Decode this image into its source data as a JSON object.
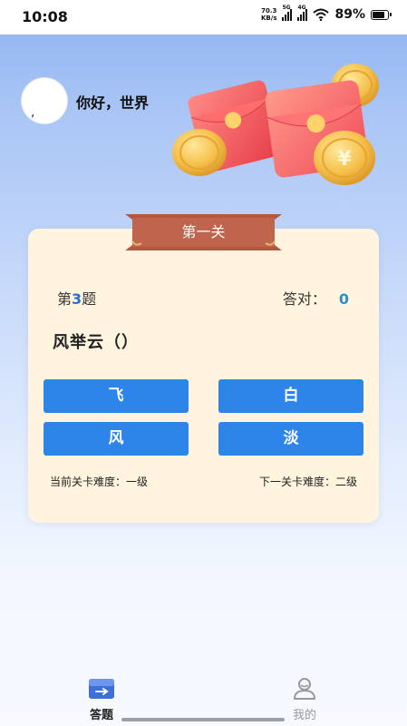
{
  "status_bar": {
    "time": "10:08",
    "net_speed_value": "70.3",
    "net_speed_unit": "KB/s",
    "signal1_label": "5G",
    "signal2_label": "4G",
    "battery_percent": "89%",
    "battery_level": 0.89
  },
  "header": {
    "avatar_mark": ",",
    "greeting": "你好，世界"
  },
  "quiz": {
    "level_title": "第一关",
    "question_prefix": "第",
    "question_index": "3",
    "question_suffix": "题",
    "correct_label": "答对：",
    "correct_count": "0",
    "question_text": "风举云（）",
    "options": [
      "飞",
      "白",
      "风",
      "淡"
    ],
    "current_difficulty": "当前关卡难度：一级",
    "next_difficulty": "下一关卡难度：二级"
  },
  "bottom_nav": {
    "items": [
      {
        "label": "答题",
        "icon": "quiz-icon",
        "active": true
      },
      {
        "label": "我的",
        "icon": "profile-icon",
        "active": false
      }
    ]
  },
  "colors": {
    "accent": "#2d85ea",
    "card_bg": "#fff5df",
    "ribbon": "#b5563f",
    "active_tab": "#3c6fd8"
  }
}
